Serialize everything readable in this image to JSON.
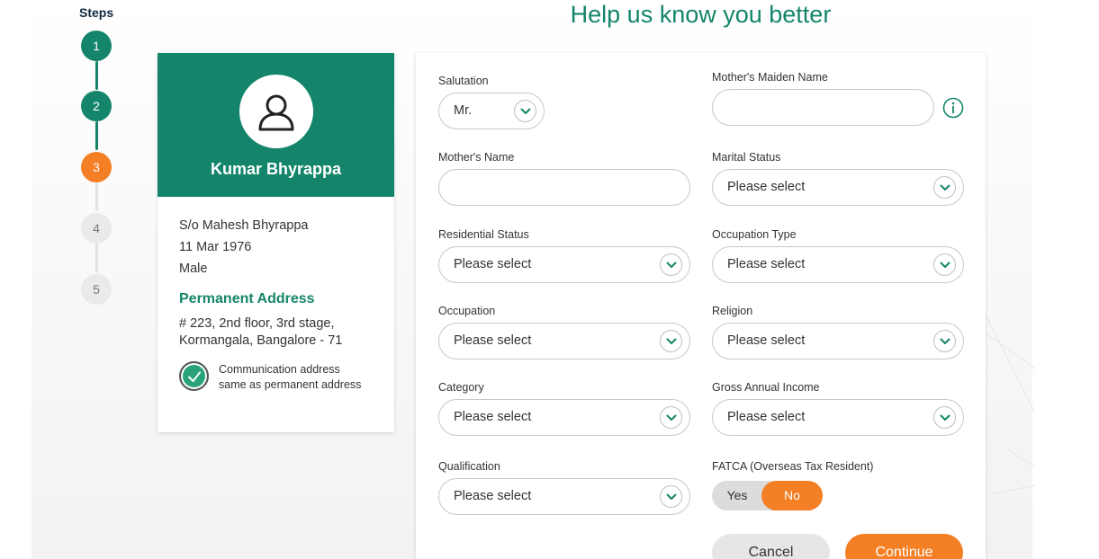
{
  "steps": {
    "title": "Steps",
    "items": [
      {
        "label": "1",
        "state": "done"
      },
      {
        "label": "2",
        "state": "done"
      },
      {
        "label": "3",
        "state": "current"
      },
      {
        "label": "4",
        "state": "todo"
      },
      {
        "label": "5",
        "state": "todo"
      }
    ]
  },
  "page": {
    "title": "Help us know you better"
  },
  "profile": {
    "name": "Kumar Bhyrappa",
    "relation": "S/o Mahesh Bhyrappa",
    "dob": "11 Mar 1976",
    "gender": "Male",
    "address_title": "Permanent Address",
    "address_line1": "# 223, 2nd floor, 3rd stage,",
    "address_line2": "Kormangala, Bangalore - 71",
    "comm_line1": "Communication address",
    "comm_line2": "same as permanent address",
    "comm_checked": true
  },
  "form": {
    "salutation": {
      "label": "Salutation",
      "value": "Mr."
    },
    "maiden_name": {
      "label": "Mother's Maiden Name",
      "value": ""
    },
    "mothers_name": {
      "label": "Mother's Name",
      "value": ""
    },
    "marital_status": {
      "label": "Marital Status",
      "value": "Please select"
    },
    "residential_status": {
      "label": "Residential Status",
      "value": "Please select"
    },
    "occupation_type": {
      "label": "Occupation Type",
      "value": "Please select"
    },
    "occupation": {
      "label": "Occupation",
      "value": "Please select"
    },
    "religion": {
      "label": "Religion",
      "value": "Please select"
    },
    "category": {
      "label": "Category",
      "value": "Please select"
    },
    "gross_income": {
      "label": "Gross Annual Income",
      "value": "Please select"
    },
    "qualification": {
      "label": "Qualification",
      "value": "Please select"
    },
    "fatca": {
      "label": "FATCA (Overseas Tax Resident)",
      "yes": "Yes",
      "no": "No",
      "selected": "No"
    }
  },
  "buttons": {
    "cancel": "Cancel",
    "continue": "Continue"
  },
  "colors": {
    "primary": "#14856a",
    "accent": "#f47f24"
  },
  "icons": {
    "avatar": "user-icon",
    "chevron": "chevron-down-icon",
    "info": "info-icon",
    "check": "check-icon"
  }
}
